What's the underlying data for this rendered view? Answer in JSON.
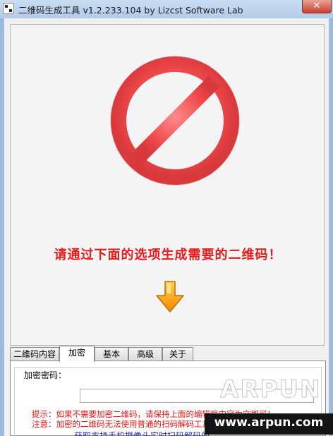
{
  "window": {
    "title": "二维码生成工具 v1.2.233.104   by Lizcst Software Lab",
    "close_label": "✕"
  },
  "display": {
    "status_icon": "forbidden-icon",
    "message": "请通过下面的选项生成需要的二维码！",
    "arrow_icon": "down-arrow-icon"
  },
  "tabs": [
    {
      "label": "二维码内容",
      "active": false
    },
    {
      "label": "加密",
      "active": true
    },
    {
      "label": "基本",
      "active": false
    },
    {
      "label": "高级",
      "active": false
    },
    {
      "label": "关于",
      "active": false
    }
  ],
  "encrypt_panel": {
    "group_title": "加密密码：",
    "password_value": "",
    "hint1": "提示：如果不需要加密二维码，请保持上面的编辑框内容为空即可！",
    "hint2": "注意：加密的二维码无法使用普通的扫码解码工具识别，需要使用本",
    "link": "获取支持手机摄像头实时扫码解码的"
  },
  "watermark": {
    "brand": "ARPUN",
    "url": "www.arpun.com"
  },
  "colors": {
    "message_red": "#e31b1b",
    "hint_red": "#e01212",
    "link_blue": "#1a27b8",
    "titlebar": "#b3cbe9"
  }
}
